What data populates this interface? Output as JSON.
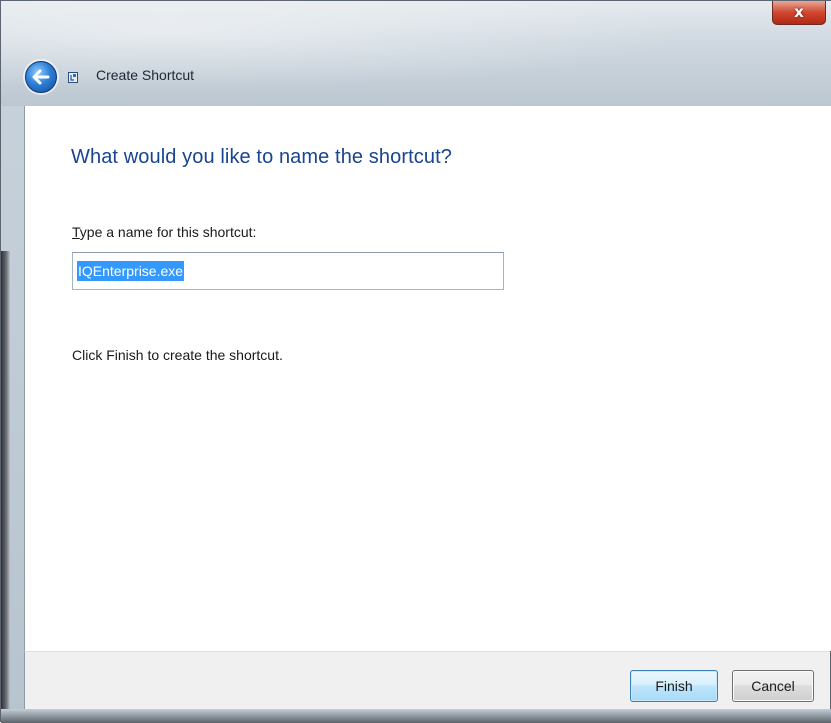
{
  "window": {
    "title": "Create Shortcut",
    "close_glyph": "x"
  },
  "icons": {
    "back": "back-arrow-icon",
    "app": "shortcut-wizard-icon",
    "close": "close-icon"
  },
  "main": {
    "heading": "What would you like to name the shortcut?",
    "field_label_mnemonic": "T",
    "field_label_rest": "ype a name for this shortcut:",
    "field_value": "IQEnterprise.exe",
    "hint": "Click Finish to create the shortcut."
  },
  "footer": {
    "finish_label": "Finish",
    "cancel_label": "Cancel"
  },
  "colors": {
    "heading": "#19448f",
    "selection": "#3399ff",
    "close_button": "#d0462f"
  }
}
